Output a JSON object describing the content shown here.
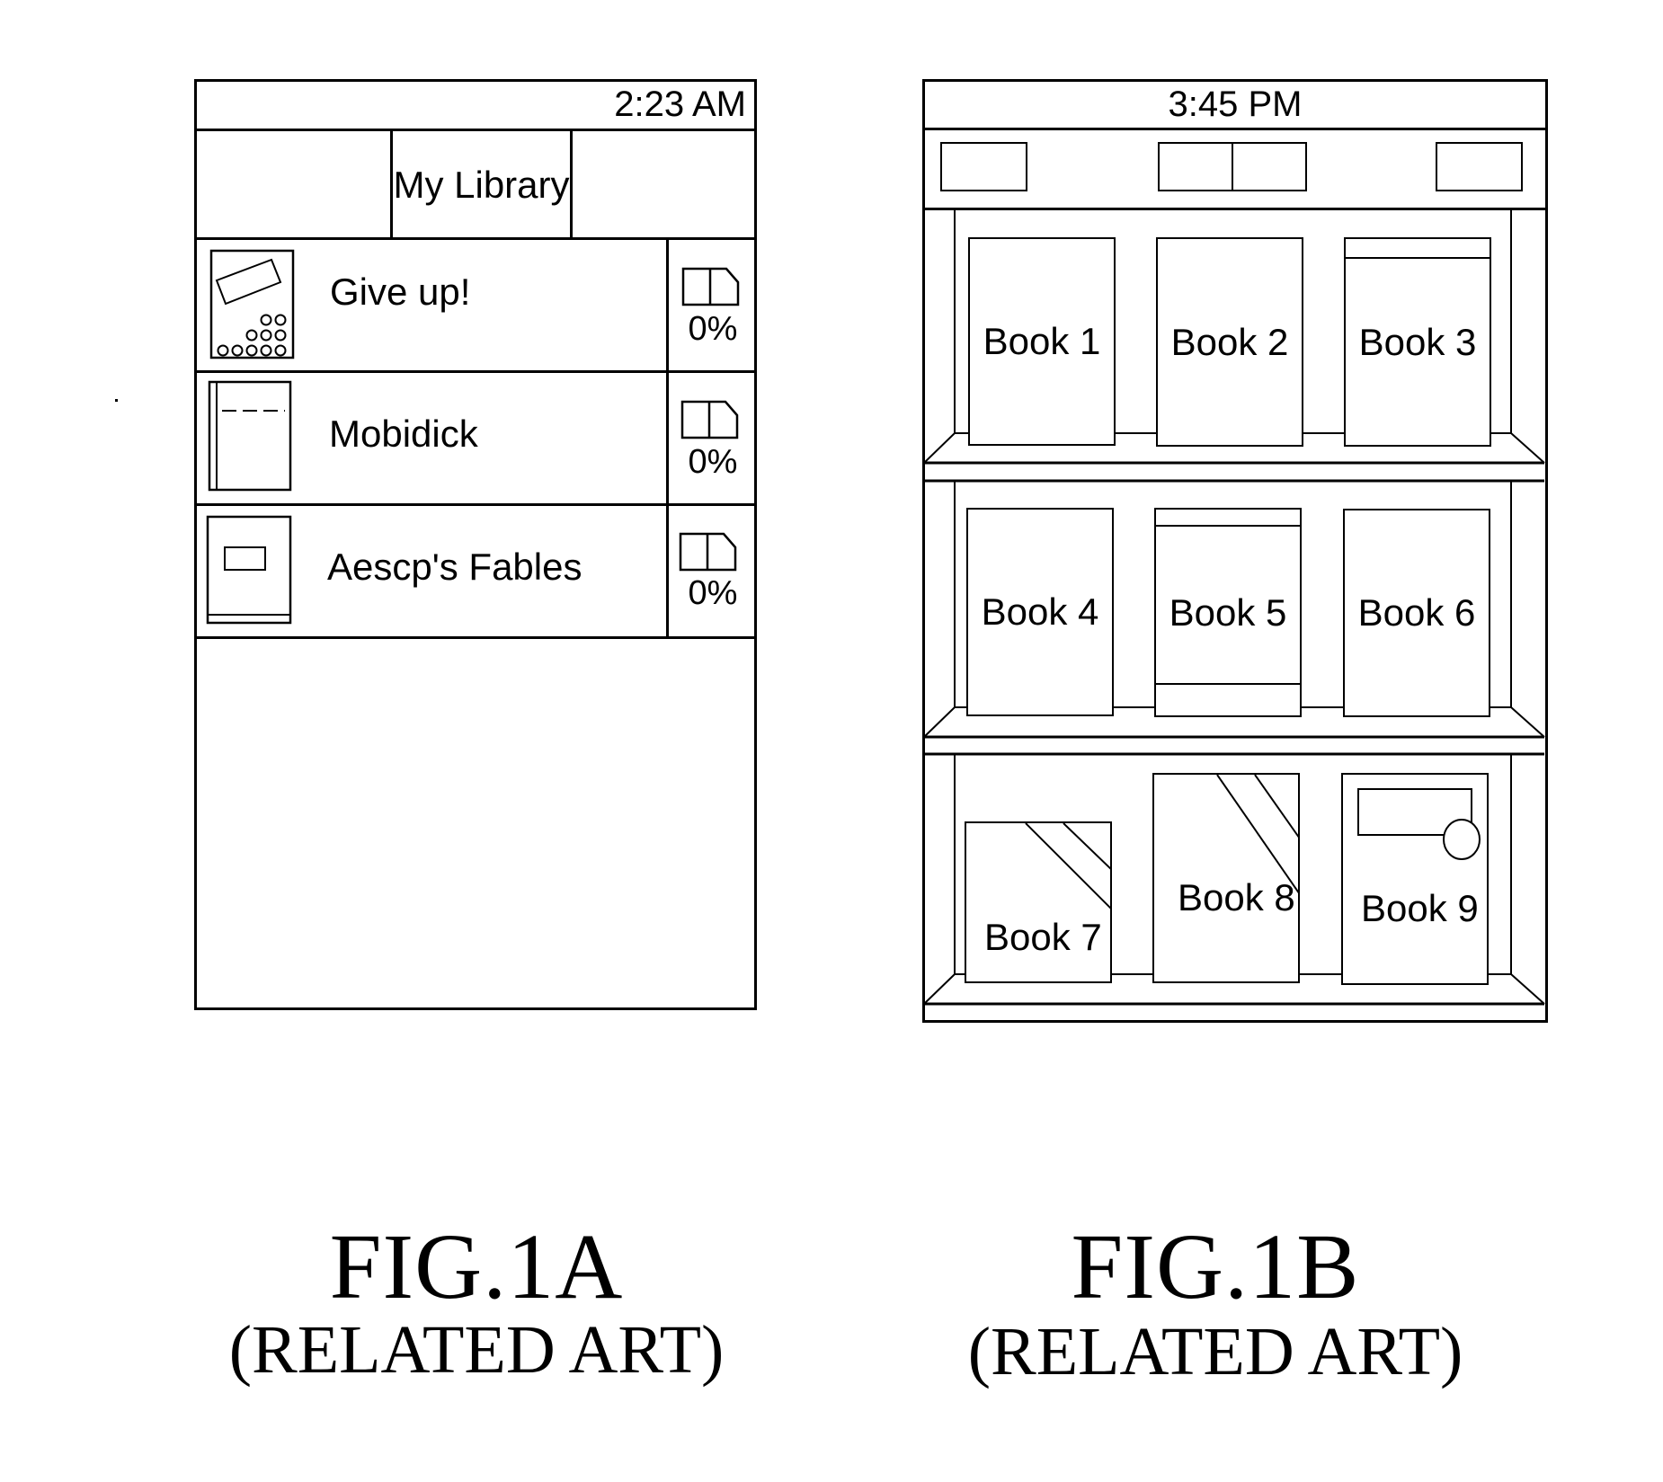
{
  "figures": {
    "fig1a": {
      "status_time": "2:23 AM",
      "header_title": "My Library",
      "books": [
        {
          "title": "Give up!",
          "progress_label": "0%",
          "progress": 0,
          "cover_icon": "book-cover-tablet-icon"
        },
        {
          "title": "Mobidick",
          "progress_label": "0%",
          "progress": 0,
          "cover_icon": "book-cover-plain-icon"
        },
        {
          "title": "Aescp's Fables",
          "progress_label": "0%",
          "progress": 0,
          "cover_icon": "book-cover-label-icon"
        }
      ],
      "progress_icon": "open-book-icon",
      "caption": "FIG.1A",
      "caption_sub": "(RELATED ART)"
    },
    "fig1b": {
      "status_time": "3:45 PM",
      "toolbar_buttons": [
        "left-button",
        "view-toggle-left",
        "view-toggle-right",
        "right-button"
      ],
      "shelves": [
        [
          "Book 1",
          "Book 2",
          "Book 3"
        ],
        [
          "Book 4",
          "Book 5",
          "Book 6"
        ],
        [
          "Book 7",
          "Book 8",
          "Book 9"
        ]
      ],
      "caption": "FIG.1B",
      "caption_sub": "(RELATED ART)"
    }
  }
}
